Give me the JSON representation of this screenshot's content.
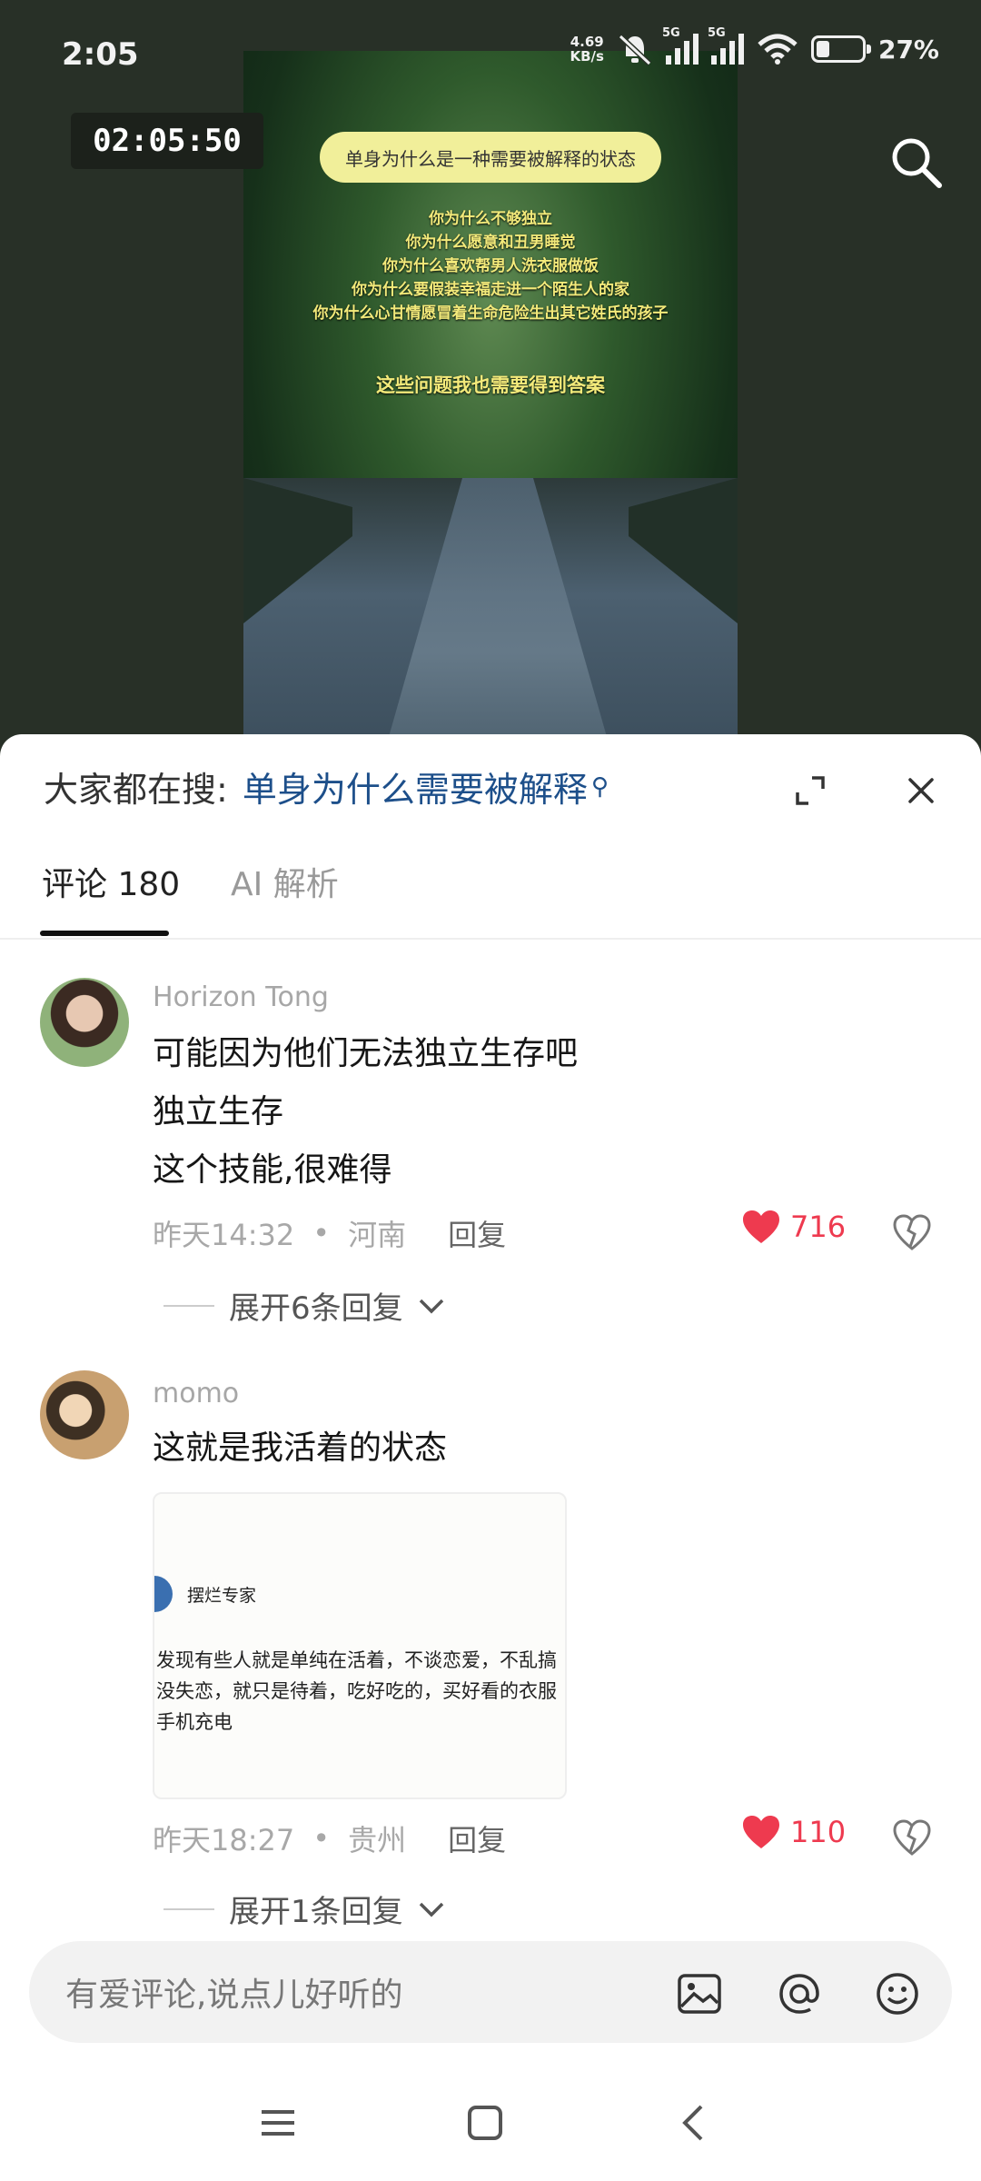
{
  "status_bar": {
    "time": "2:05",
    "net_speed_value": "4.69",
    "net_speed_unit": "KB/s",
    "signal1_label": "5G",
    "signal2_label": "5G",
    "battery_percent": "27%"
  },
  "video": {
    "timer": "02:05:50",
    "pill_text": "单身为什么是一种需要被解释的状态",
    "lines": [
      "你为什么不够独立",
      "你为什么愿意和丑男睡觉",
      "你为什么喜欢帮男人洗衣服做饭",
      "你为什么要假装幸福走进一个陌生人的家",
      "你为什么心甘情愿冒着生命危险生出其它姓氏的孩子"
    ],
    "answer_line": "这些问题我也需要得到答案"
  },
  "sheet": {
    "search_prefix": "大家都在搜:",
    "search_query": "单身为什么需要被解释",
    "tabs": [
      {
        "label": "评论 180"
      },
      {
        "label": "AI 解析"
      }
    ]
  },
  "comments": [
    {
      "user": "Horizon Tong",
      "lines": [
        "可能因为他们无法独立生存吧",
        "独立生存",
        "这个技能,很难得"
      ],
      "time": "昨天14:32",
      "dot": "•",
      "location": "河南",
      "reply_label": "回复",
      "likes": "716",
      "expand_label": "展开6条回复"
    },
    {
      "user": "momo",
      "lines": [
        "这就是我活着的状态"
      ],
      "image_card": {
        "author": "摆烂专家",
        "text": "发现有些人就是单纯在活着，不谈恋爱，不乱搞\n没失恋，就只是待着，吃好吃的，买好看的衣服\n手机充电"
      },
      "time": "昨天18:27",
      "dot": "•",
      "location": "贵州",
      "reply_label": "回复",
      "likes": "110",
      "expand_label": "展开1条回复"
    }
  ],
  "input": {
    "placeholder": "有爱评论,说点儿好听的"
  },
  "colors": {
    "accent_link": "#1d4f8a",
    "like_red": "#ee3a4f",
    "pill_yellow": "#f1ef9a"
  }
}
